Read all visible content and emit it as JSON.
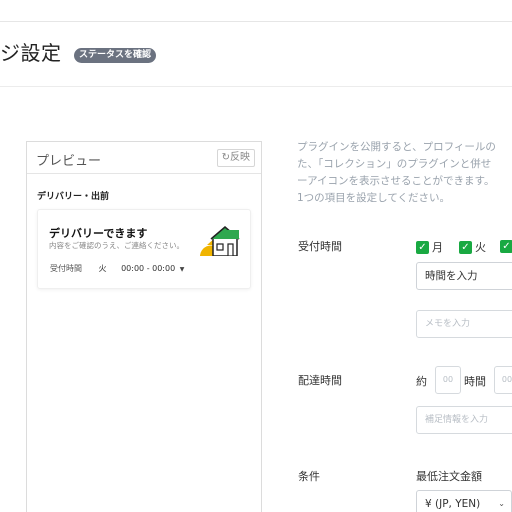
{
  "header": {
    "title": "ジ設定",
    "status_button": "ステータスを確認"
  },
  "preview": {
    "title": "プレビュー",
    "reflect_button": "反映",
    "section_label": "デリバリー・出前",
    "card": {
      "title": "デリバリーできます",
      "subtitle": "内容をご確認のうえ、ご連絡ください。",
      "row_label": "受付時間",
      "row_day": "火",
      "row_time": "00:00 - 00:00",
      "icon": "house-icon"
    }
  },
  "description": {
    "lines": [
      "プラグインを公開すると、プロフィールの",
      "た、「コレクション」のプラグインと併せ",
      "ーアイコンを表示させることができます。",
      "1つの項目を設定してください。"
    ]
  },
  "reception": {
    "label": "受付時間",
    "days": [
      {
        "label": "月",
        "checked": true
      },
      {
        "label": "火",
        "checked": true
      },
      {
        "label": "",
        "checked": true
      }
    ],
    "time_select": "時間を入力",
    "memo_placeholder": "メモを入力"
  },
  "delivery_time": {
    "label": "配達時間",
    "approx": "約",
    "hour_placeholder": "00",
    "hour_unit": "時間",
    "minute_placeholder": "00",
    "extra_placeholder": "補足情報を入力"
  },
  "conditions": {
    "label": "条件",
    "min_order_label": "最低注文金額",
    "currency_select": "¥ (JP, YEN)"
  },
  "colors": {
    "accent_green": "#19a942",
    "status_badge": "#6b7280",
    "description_text": "#9aa3ad"
  }
}
